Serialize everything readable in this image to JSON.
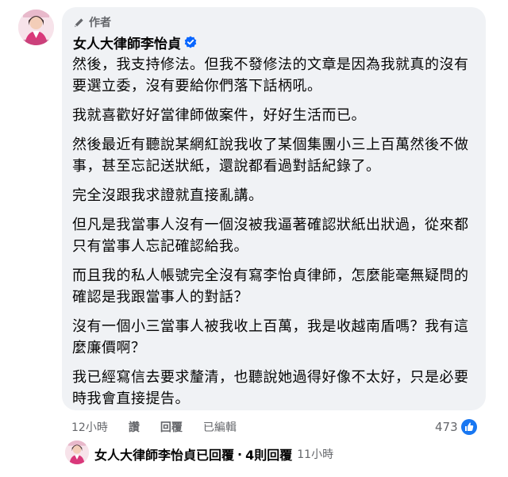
{
  "comment": {
    "author_tag": "作者",
    "author_name": "女人大律師李怡貞",
    "paragraphs": [
      "然後，我支持修法。但我不發修法的文章是因為我就真的沒有要選立委，沒有要給你們落下話柄吼。",
      "我就喜歡好好當律師做案件，好好生活而已。",
      "然後最近有聽說某網紅說我收了某個集團小三上百萬然後不做事，甚至忘記送狀紙，還說都看過對話紀錄了。",
      "完全沒跟我求證就直接亂講。",
      "但凡是我當事人沒有一個沒被我逼著確認狀紙出狀過，從來都只有當事人忘記確認給我。",
      "而且我的私人帳號完全沒有寫李怡貞律師，怎麼能毫無疑問的確認是我跟當事人的對話？",
      "沒有一個小三當事人被我收上百萬，我是收越南盾嗎？我有這麼廉價啊？",
      "我已經寫信去要求釐清，也聽說她過得好像不太好，只是必要時我會直接提告。"
    ]
  },
  "actions": {
    "time": "12小時",
    "like": "讚",
    "reply": "回覆",
    "edited": "已編輯"
  },
  "reactions": {
    "count": "473",
    "icon": "like-icon"
  },
  "reply_summary": {
    "replier": "女人大律師李怡貞",
    "replied": "已回覆",
    "separator": "·",
    "count_text": "4則回覆",
    "time": "11小時"
  },
  "colors": {
    "bubble": "#f0f2f5",
    "secondary_text": "#65676b",
    "verified": "#0866ff",
    "like": "#1877f2"
  }
}
